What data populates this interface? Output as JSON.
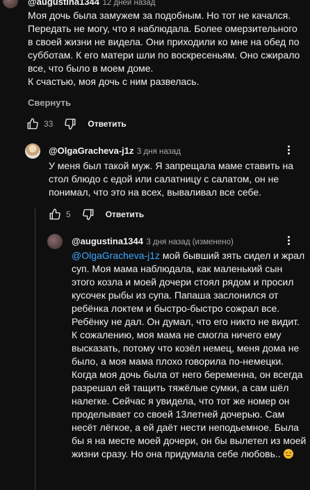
{
  "comment1": {
    "author": "@augustina1344",
    "time": "12 дней назад",
    "text": "Моя дочь была замужем за подобным. Но тот не качался. Передать не могу, что я наблюдала. Более омерзительного в своей жизни не видела. Они приходили ко мне на обед по субботам. К его матери шли по воскресеньям. Оно сжирало все, что было в моем доме.\nК счастью, моя дочь с ним развелась.",
    "collapse_label": "Свернуть",
    "likes": "33",
    "reply_label": "Ответить"
  },
  "reply1": {
    "author": "@OlgaGracheva-j1z",
    "time": "3 дня назад",
    "text": "У меня был такой муж. Я запрещала маме ставить на стол блюдо с едой или салатницу с салатом, он не понимал, что это на всех, вываливал все себе.",
    "likes": "5",
    "reply_label": "Ответить"
  },
  "reply2": {
    "author": "@augustina1344",
    "time": "3 дня назад (изменено)",
    "mention": "@OlgaGracheva-j1z",
    "text": " мой бывший зять сидел и жрал суп. Моя мама наблюдала, как маленький сын этого козла и моей дочери стоял рядом и просил кусочек рыбы из супа. Папаша заслонился от ребёнка локтем и быстро-быстро сожрал все. Ребёнку не дал. Он думал, что его никто не видит. К сожалению, моя мама не смогла ничего ему высказать, потому что козёл немец, меня дома не было, а моя мама плохо говорила по-немецки. Когда моя дочь была от него беременна, он всегда разрешал ей тащить тяжёлые сумки, а сам шёл налегке. Сейчас я увидела, что тот же номер он проделывает со своей 13летней дочерью. Сам несёт лёгкое, а ей даёт нести неподьемное. Была бы я на месте моей дочери, он бы вылетел из моей жизни сразу. Но она придумала себе любовь.. ",
    "emoji": "unamused-face-icon"
  },
  "colors": {
    "background": "#0f0f0f",
    "text": "#f1f1f1",
    "secondary": "#aaaaaa",
    "mention": "#3ea6ff"
  }
}
